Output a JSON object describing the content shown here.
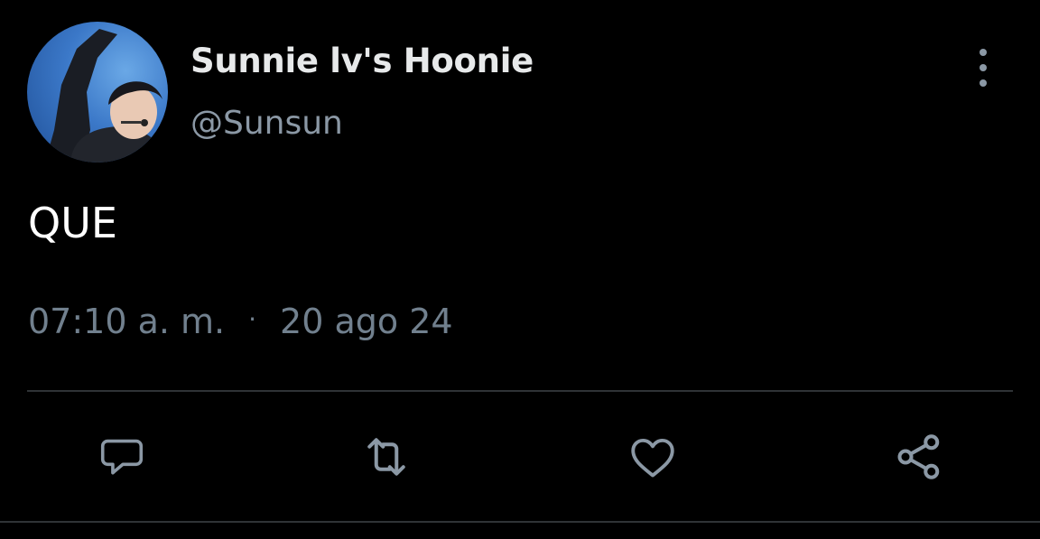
{
  "author": {
    "display_name": "Sunnie lv's Hoonie",
    "handle": "@Sunsun",
    "avatar_icon": "profile-photo"
  },
  "tweet": {
    "text": "QUE",
    "time": "07:10 a. m.",
    "separator": "·",
    "date": "20 ago 24"
  },
  "actions": [
    {
      "name": "reply",
      "icon": "speech-bubble-icon"
    },
    {
      "name": "retweet",
      "icon": "retweet-arrows-icon"
    },
    {
      "name": "like",
      "icon": "heart-icon"
    },
    {
      "name": "share",
      "icon": "share-nodes-icon"
    }
  ],
  "colors": {
    "background": "#000000",
    "primary_text": "#e7e9ea",
    "secondary_text": "#8b98a5",
    "divider": "#2f3336"
  }
}
